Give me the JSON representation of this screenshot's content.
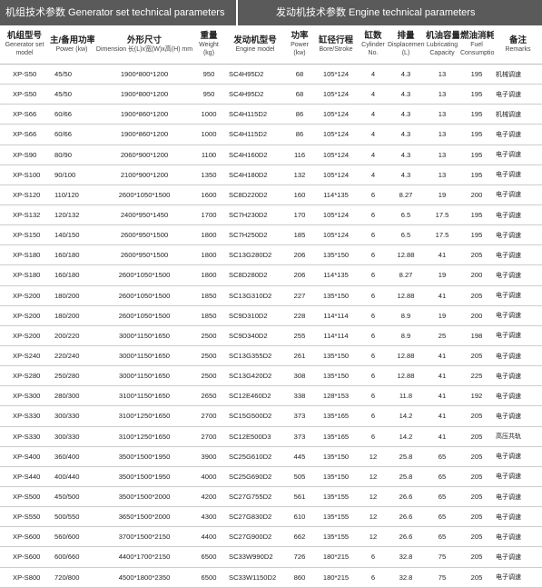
{
  "banner": {
    "generator": "机组技术参数  Generator set technical parameters",
    "engine": "发动机技术参数  Engine technical parameters"
  },
  "headers": [
    {
      "cn": "机组型号",
      "en": "Generator set model"
    },
    {
      "cn": "主/备用功率",
      "en": "Power (kw)"
    },
    {
      "cn": "外形尺寸",
      "en": "Dimension 长(L)x宽(W)x高(H) mm"
    },
    {
      "cn": "重量",
      "en": "Weight (kg)"
    },
    {
      "cn": "发动机型号",
      "en": "Engine model"
    },
    {
      "cn": "功率",
      "en": "Power (kw)"
    },
    {
      "cn": "缸径行程",
      "en": "Bore/Stroke"
    },
    {
      "cn": "缸数",
      "en": "Cylinder No."
    },
    {
      "cn": "排量",
      "en": "Displacement (L)"
    },
    {
      "cn": "机油容量",
      "en": "Lubricating Capacity"
    },
    {
      "cn": "燃油消耗",
      "en": "Fuel Consumption"
    },
    {
      "cn": "备注",
      "en": "Remarks"
    }
  ],
  "rows": [
    [
      "XP-S50",
      "45/50",
      "1900*800*1200",
      "950",
      "SC4H95D2",
      "68",
      "105*124",
      "4",
      "4.3",
      "13",
      "195",
      "机械调速"
    ],
    [
      "XP-S50",
      "45/50",
      "1900*800*1200",
      "950",
      "SC4H95D2",
      "68",
      "105*124",
      "4",
      "4.3",
      "13",
      "195",
      "电子调速"
    ],
    [
      "XP-S66",
      "60/66",
      "1900*860*1200",
      "1000",
      "SC4H115D2",
      "86",
      "105*124",
      "4",
      "4.3",
      "13",
      "195",
      "机械调速"
    ],
    [
      "XP-S66",
      "60/66",
      "1900*860*1200",
      "1000",
      "SC4H115D2",
      "86",
      "105*124",
      "4",
      "4.3",
      "13",
      "195",
      "电子调速"
    ],
    [
      "XP-S90",
      "80/90",
      "2060*900*1200",
      "1100",
      "SC4H160D2",
      "116",
      "105*124",
      "4",
      "4.3",
      "13",
      "195",
      "电子调速"
    ],
    [
      "XP-S100",
      "90/100",
      "2100*900*1200",
      "1350",
      "SC4H180D2",
      "132",
      "105*124",
      "4",
      "4.3",
      "13",
      "195",
      "电子调速"
    ],
    [
      "XP-S120",
      "110/120",
      "2600*1050*1500",
      "1600",
      "SC8D220D2",
      "160",
      "114*135",
      "6",
      "8.27",
      "19",
      "200",
      "电子调速"
    ],
    [
      "XP-S132",
      "120/132",
      "2400*950*1450",
      "1700",
      "SC7H230D2",
      "170",
      "105*124",
      "6",
      "6.5",
      "17.5",
      "195",
      "电子调速"
    ],
    [
      "XP-S150",
      "140/150",
      "2600*950*1500",
      "1800",
      "SC7H250D2",
      "185",
      "105*124",
      "6",
      "6.5",
      "17.5",
      "195",
      "电子调速"
    ],
    [
      "XP-S180",
      "160/180",
      "2600*950*1500",
      "1800",
      "SC13G280D2",
      "206",
      "135*150",
      "6",
      "12.88",
      "41",
      "205",
      "电子调速"
    ],
    [
      "XP-S180",
      "160/180",
      "2600*1050*1500",
      "1800",
      "SC8D280D2",
      "206",
      "114*135",
      "6",
      "8.27",
      "19",
      "200",
      "电子调速"
    ],
    [
      "XP-S200",
      "180/200",
      "2600*1050*1500",
      "1850",
      "SC13G310D2",
      "227",
      "135*150",
      "6",
      "12.88",
      "41",
      "205",
      "电子调速"
    ],
    [
      "XP-S200",
      "180/200",
      "2600*1050*1500",
      "1850",
      "SC9D310D2",
      "228",
      "114*114",
      "6",
      "8.9",
      "19",
      "200",
      "电子调速"
    ],
    [
      "XP-S200",
      "200/220",
      "3000*1150*1650",
      "2500",
      "SC9D340D2",
      "255",
      "114*114",
      "6",
      "8.9",
      "25",
      "198",
      "电子调速"
    ],
    [
      "XP-S240",
      "220/240",
      "3000*1150*1650",
      "2500",
      "SC13G355D2",
      "261",
      "135*150",
      "6",
      "12.88",
      "41",
      "205",
      "电子调速"
    ],
    [
      "XP-S280",
      "250/280",
      "3000*1150*1650",
      "2500",
      "SC13G420D2",
      "308",
      "135*150",
      "6",
      "12.88",
      "41",
      "225",
      "电子调速"
    ],
    [
      "XP-S300",
      "280/300",
      "3100*1150*1650",
      "2650",
      "SC12E460D2",
      "338",
      "128*153",
      "6",
      "11.8",
      "41",
      "192",
      "电子调速"
    ],
    [
      "XP-S330",
      "300/330",
      "3100*1250*1650",
      "2700",
      "SC15G500D2",
      "373",
      "135*165",
      "6",
      "14.2",
      "41",
      "205",
      "电子调速"
    ],
    [
      "XP-S330",
      "300/330",
      "3100*1250*1650",
      "2700",
      "SC12E500D3",
      "373",
      "135*165",
      "6",
      "14.2",
      "41",
      "205",
      "高压共轨"
    ],
    [
      "XP-S400",
      "360/400",
      "3500*1500*1950",
      "3900",
      "SC25G610D2",
      "445",
      "135*150",
      "12",
      "25.8",
      "65",
      "205",
      "电子调速"
    ],
    [
      "XP-S440",
      "400/440",
      "3500*1500*1950",
      "4000",
      "SC25G690D2",
      "505",
      "135*150",
      "12",
      "25.8",
      "65",
      "205",
      "电子调速"
    ],
    [
      "XP-S500",
      "450/500",
      "3500*1500*2000",
      "4200",
      "SC27G755D2",
      "561",
      "135*155",
      "12",
      "26.6",
      "65",
      "205",
      "电子调速"
    ],
    [
      "XP-S550",
      "500/550",
      "3650*1500*2000",
      "4300",
      "SC27G830D2",
      "610",
      "135*155",
      "12",
      "26.6",
      "65",
      "205",
      "电子调速"
    ],
    [
      "XP-S600",
      "560/600",
      "3700*1500*2150",
      "4400",
      "SC27G900D2",
      "662",
      "135*155",
      "12",
      "26.6",
      "65",
      "205",
      "电子调速"
    ],
    [
      "XP-S600",
      "600/660",
      "4400*1700*2150",
      "6500",
      "SC33W990D2",
      "726",
      "180*215",
      "6",
      "32.8",
      "75",
      "205",
      "电子调速"
    ],
    [
      "XP-S800",
      "720/800",
      "4500*1800*2350",
      "6500",
      "SC33W1150D2",
      "860",
      "180*215",
      "6",
      "32.8",
      "75",
      "205",
      "电子调速"
    ]
  ]
}
